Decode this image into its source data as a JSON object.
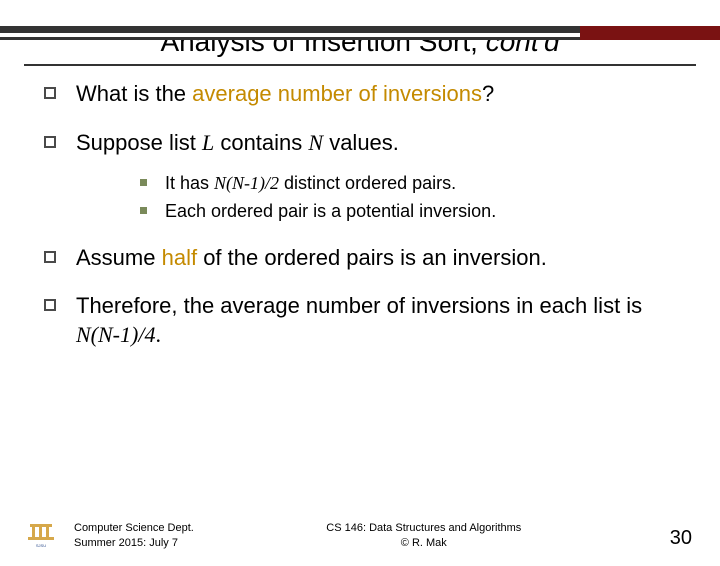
{
  "title": {
    "main": "Analysis of Insertion Sort, ",
    "contd": "cont'd"
  },
  "bullets": [
    {
      "pre": "What is the ",
      "hl": "average number of inversions",
      "post": "?"
    },
    {
      "pre": "Suppose list ",
      "var1": "L",
      "mid": " contains ",
      "var2": "N",
      "post": " values."
    }
  ],
  "subbullets": [
    {
      "pre": "It has ",
      "math": "N(N-1)/2",
      "post": " distinct ordered pairs."
    },
    {
      "pre": "Each ordered pair is a potential inversion.",
      "math": "",
      "post": ""
    }
  ],
  "bullets2": [
    {
      "pre": "Assume ",
      "hl": "half",
      "post": " of the ordered pairs is an inversion."
    },
    {
      "pre": "Therefore, the average number of inversions in each list is ",
      "math": "N(N-1)/4",
      "post": "."
    }
  ],
  "footer": {
    "left_line1": "Computer Science Dept.",
    "left_line2": "Summer 2015: July 7",
    "center_line1": "CS 146: Data Structures and Algorithms",
    "center_line2": "© R. Mak",
    "page": "30",
    "logo_label": "San Jose State"
  }
}
